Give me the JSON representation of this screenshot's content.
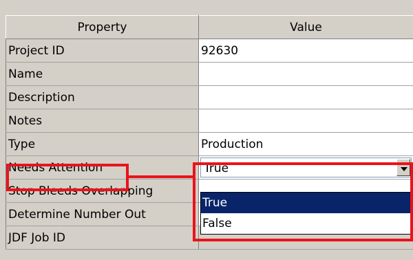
{
  "grid": {
    "headers": {
      "property": "Property",
      "value": "Value"
    },
    "rows": [
      {
        "property": "Project ID",
        "value": "92630"
      },
      {
        "property": "Name",
        "value": ""
      },
      {
        "property": "Description",
        "value": ""
      },
      {
        "property": "Notes",
        "value": ""
      },
      {
        "property": "Type",
        "value": "Production"
      },
      {
        "property": "Needs Attention",
        "value": "True"
      },
      {
        "property": "Stop Bleeds Overlapping",
        "value": ""
      },
      {
        "property": "Determine Number Out",
        "value": ""
      },
      {
        "property": "JDF Job ID",
        "value": ""
      }
    ]
  },
  "dropdown": {
    "selected": "True",
    "options": [
      "True",
      "False"
    ]
  },
  "colors": {
    "highlight": "#e8141b",
    "selection": "#0a246a",
    "panel": "#d4d0c8"
  },
  "icons": {
    "dropdown_button": "chevron-down-icon"
  }
}
